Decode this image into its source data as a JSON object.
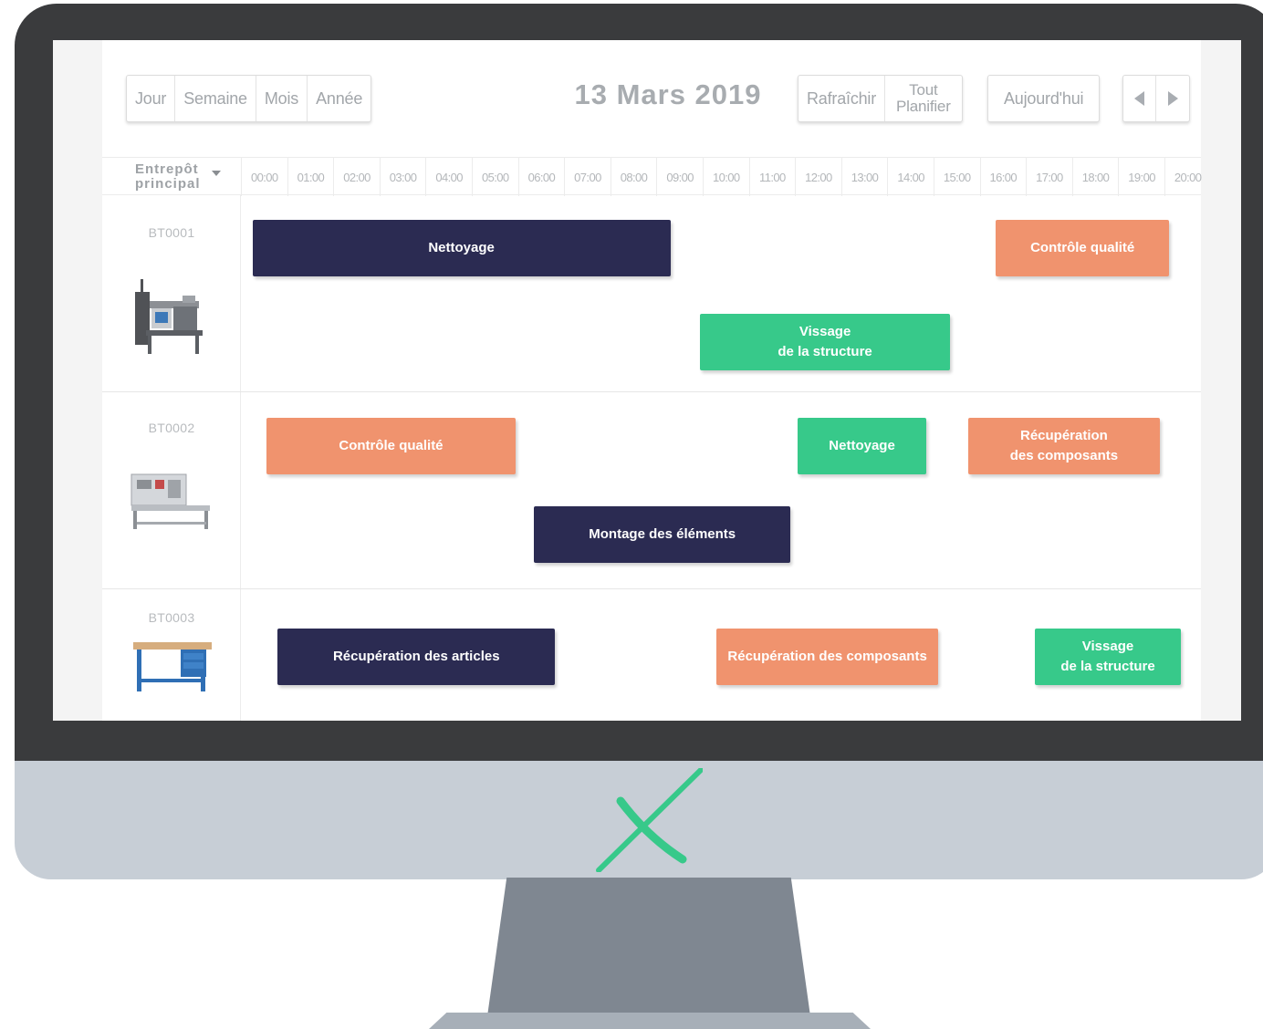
{
  "toolbar": {
    "views": [
      "Jour",
      "Semaine",
      "Mois",
      "Année"
    ],
    "refresh_label": "Rafraîchir",
    "plan_all_label": [
      "Tout",
      "Planifier"
    ],
    "today_label": "Aujourd'hui",
    "prev_icon": "chevron-left-icon",
    "next_icon": "chevron-right-icon"
  },
  "date_title": "13 Mars 2019",
  "warehouse": {
    "label_lines": [
      "Entrepôt",
      "principal"
    ],
    "icon": "caret-down-icon"
  },
  "hours": [
    "00:00",
    "01:00",
    "02:00",
    "03:00",
    "04:00",
    "05:00",
    "06:00",
    "07:00",
    "08:00",
    "09:00",
    "10:00",
    "11:00",
    "12:00",
    "13:00",
    "14:00",
    "15:00",
    "16:00",
    "17:00",
    "18:00",
    "19:00",
    "20:00"
  ],
  "colors": {
    "navy": "#2b2b52",
    "orange": "#f0936e",
    "green": "#37c98a"
  },
  "resources": [
    {
      "name": "BT0001",
      "image": "workstation-machine-image",
      "tasks": [
        {
          "label": "Nettoyage",
          "color": "navy",
          "start": 0.25,
          "end": 9.3
        },
        {
          "label": "Contrôle qualité",
          "color": "orange",
          "start": 16.35,
          "end": 20.1
        },
        {
          "label": "Vissage\nde la structure",
          "color": "green",
          "start": 9.95,
          "end": 15.35
        }
      ]
    },
    {
      "name": "BT0002",
      "image": "test-bench-image",
      "tasks": [
        {
          "label": "Contrôle qualité",
          "color": "orange",
          "start": 0.55,
          "end": 5.95
        },
        {
          "label": "Nettoyage",
          "color": "green",
          "start": 12.05,
          "end": 14.85
        },
        {
          "label": "Récupération\ndes composants",
          "color": "orange",
          "start": 15.75,
          "end": 19.9
        },
        {
          "label": "Montage des éléments",
          "color": "navy",
          "start": 6.35,
          "end": 11.9
        }
      ]
    },
    {
      "name": "BT0003",
      "image": "workbench-drawers-image",
      "tasks": [
        {
          "label": "Récupération des articles",
          "color": "navy",
          "start": 0.8,
          "end": 6.8
        },
        {
          "label": "Récupération des composants",
          "color": "orange",
          "start": 10.3,
          "end": 15.1
        },
        {
          "label": "Vissage\nde la structure",
          "color": "green",
          "start": 17.2,
          "end": 20.35
        }
      ]
    }
  ]
}
